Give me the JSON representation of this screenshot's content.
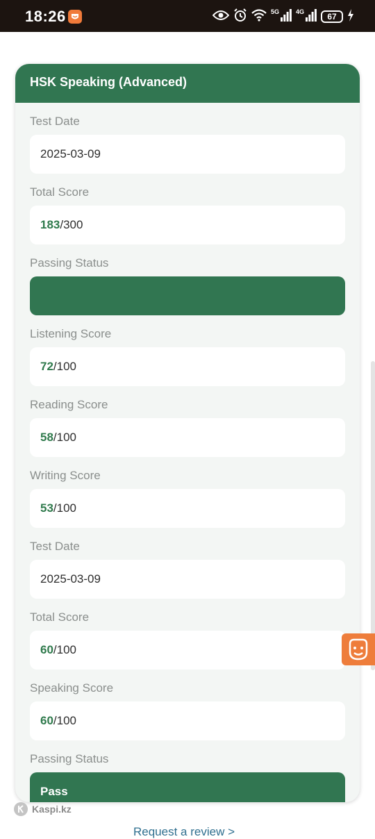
{
  "status_bar": {
    "time": "18:26",
    "network_5g": "5G",
    "network_4g": "4G",
    "battery": "67"
  },
  "card": {
    "title": "HSK Speaking (Advanced)",
    "fields": {
      "test_date_1": {
        "label": "Test Date",
        "value": "2025-03-09"
      },
      "total_score_1": {
        "label": "Total Score",
        "score": "183",
        "max": "/300"
      },
      "passing_status_1": {
        "label": "Passing Status",
        "value": ""
      },
      "listening": {
        "label": "Listening Score",
        "score": "72",
        "max": "/100"
      },
      "reading": {
        "label": "Reading Score",
        "score": "58",
        "max": "/100"
      },
      "writing": {
        "label": "Writing Score",
        "score": "53",
        "max": "/100"
      },
      "test_date_2": {
        "label": "Test Date",
        "value": "2025-03-09"
      },
      "total_score_2": {
        "label": "Total Score",
        "score": "60",
        "max": "/100"
      },
      "speaking": {
        "label": "Speaking Score",
        "score": "60",
        "max": "/100"
      },
      "passing_status_2": {
        "label": "Passing Status",
        "value": "Pass"
      }
    }
  },
  "footer": {
    "brand": "Kaspi.kz",
    "review_link": "Request a review >"
  },
  "colors": {
    "header_green": "#317651",
    "score_green": "#2f7a4c",
    "accent_orange": "#ee7d3b"
  },
  "icons": [
    "app-notification-icon",
    "eye-icon",
    "alarm-icon",
    "wifi-icon",
    "signal-icon",
    "battery-icon",
    "charging-icon",
    "assistant-face-icon",
    "kaspi-logo-icon"
  ]
}
